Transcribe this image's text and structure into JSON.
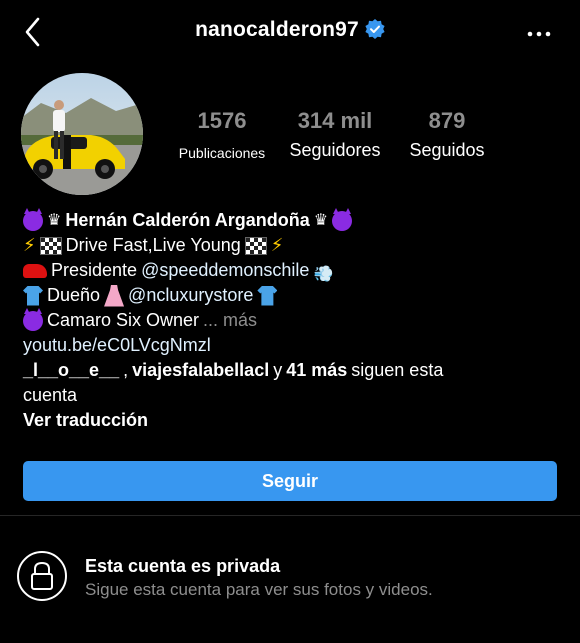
{
  "header": {
    "username": "nanocalderon97",
    "verified": true
  },
  "profile": {
    "avatar_desc": "man standing beside a yellow sports car",
    "stats": [
      {
        "value": "1576",
        "label": "Publicaciones"
      },
      {
        "value": "314 mil",
        "label": "Seguidores"
      },
      {
        "value": "879",
        "label": "Seguidos"
      }
    ]
  },
  "bio": {
    "name": "Hernán Calderón Argandoña",
    "line2": "Drive Fast,Live Young",
    "line3_prefix": "Presidente ",
    "line3_mention": "@speeddemonschile",
    "line4_prefix": "Dueño ",
    "line4_mention": "@ncluxurystore",
    "line5": "Camaro Six Owner",
    "more": "... más",
    "url": "youtu.be/eC0LVcgNmzl",
    "followed_by_user1": "_l__o__e__",
    "followed_by_sep1": ", ",
    "followed_by_user2": "viajesfalabellacl",
    "followed_by_y": " y ",
    "followed_by_more": "41 más",
    "followed_by_suffix": " siguen esta",
    "followed_by_suffix2": "cuenta",
    "translate": "Ver traducción"
  },
  "actions": {
    "follow_label": "Seguir"
  },
  "private": {
    "title": "Esta cuenta es privada",
    "subtitle": "Sigue esta cuenta para ver sus fotos y videos."
  },
  "colors": {
    "accent": "#3897f0",
    "muted": "#8e8e8e",
    "background": "#000000"
  }
}
